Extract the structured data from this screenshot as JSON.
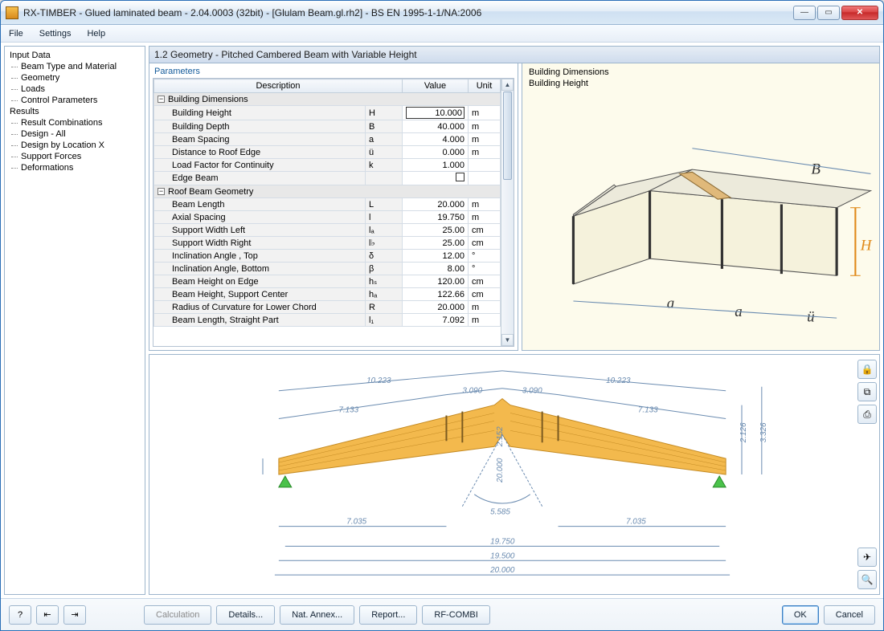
{
  "title": "RX-TIMBER - Glued laminated beam - 2.04.0003 (32bit) - [Glulam Beam.gl.rh2] - BS EN 1995-1-1/NA:2006",
  "menubar": [
    "File",
    "Settings",
    "Help"
  ],
  "sidebar": {
    "groups": [
      {
        "label": "Input Data",
        "items": [
          "Beam Type and Material",
          "Geometry",
          "Loads",
          "Control Parameters"
        ]
      },
      {
        "label": "Results",
        "items": [
          "Result Combinations",
          "Design - All",
          "Design by Location X",
          "Support Forces",
          "Deformations"
        ]
      }
    ]
  },
  "section_header": "1.2 Geometry  -  Pitched Cambered Beam with Variable Height",
  "params_label": "Parameters",
  "grid": {
    "headers": [
      "Description",
      "",
      "Value",
      "Unit"
    ],
    "groups": [
      {
        "name": "Building Dimensions",
        "rows": [
          {
            "desc": "Building Height",
            "sym": "H",
            "val": "10.000",
            "unit": "m",
            "editing": true
          },
          {
            "desc": "Building Depth",
            "sym": "B",
            "val": "40.000",
            "unit": "m"
          },
          {
            "desc": "Beam Spacing",
            "sym": "a",
            "val": "4.000",
            "unit": "m"
          },
          {
            "desc": "Distance to Roof Edge",
            "sym": "ü",
            "val": "0.000",
            "unit": "m"
          },
          {
            "desc": "Load Factor for Continuity",
            "sym": "k",
            "val": "1.000",
            "unit": ""
          },
          {
            "desc": "Edge Beam",
            "sym": "",
            "val": "",
            "unit": "",
            "checkbox": true
          }
        ]
      },
      {
        "name": "Roof Beam Geometry",
        "rows": [
          {
            "desc": "Beam Length",
            "sym": "L",
            "val": "20.000",
            "unit": "m"
          },
          {
            "desc": "Axial Spacing",
            "sym": "l",
            "val": "19.750",
            "unit": "m"
          },
          {
            "desc": "Support Width Left",
            "sym": "lₐ",
            "val": "25.00",
            "unit": "cm"
          },
          {
            "desc": "Support Width Right",
            "sym": "l♭",
            "val": "25.00",
            "unit": "cm"
          },
          {
            "desc": "Inclination Angle , Top",
            "sym": "δ",
            "val": "12.00",
            "unit": "°"
          },
          {
            "desc": "Inclination Angle, Bottom",
            "sym": "β",
            "val": "8.00",
            "unit": "°"
          },
          {
            "desc": "Beam Height on Edge",
            "sym": "hₛ",
            "val": "120.00",
            "unit": "cm"
          },
          {
            "desc": "Beam Height, Support Center",
            "sym": "hₐ",
            "val": "122.66",
            "unit": "cm"
          },
          {
            "desc": "Radius of Curvature for Lower Chord",
            "sym": "R",
            "val": "20.000",
            "unit": "m"
          },
          {
            "desc": "Beam Length, Straight Part",
            "sym": "l₁",
            "val": "7.092",
            "unit": "m"
          }
        ]
      }
    ]
  },
  "preview": {
    "line1": "Building Dimensions",
    "line2": "Building Height",
    "labels": {
      "B": "B",
      "H": "H",
      "a": "a",
      "u": "ü"
    }
  },
  "diagram": {
    "dims": {
      "top_outer_l": "10.223",
      "top_outer_r": "10.223",
      "top_inner_l": "3.090",
      "top_inner_r": "3.090",
      "mid_l": "7.133",
      "mid_r": "7.133",
      "h_apex": "2.152",
      "h_r1": "2.126",
      "h_r2": "3.326",
      "radius": "20.000",
      "arc": "5.585",
      "bottom_l": "7.035",
      "bottom_r": "7.035",
      "span1": "19.750",
      "span2": "19.500",
      "span3": "20.000"
    }
  },
  "footer": {
    "calculation": "Calculation",
    "details": "Details...",
    "nat": "Nat. Annex...",
    "report": "Report...",
    "combi": "RF-COMBI",
    "ok": "OK",
    "cancel": "Cancel"
  }
}
